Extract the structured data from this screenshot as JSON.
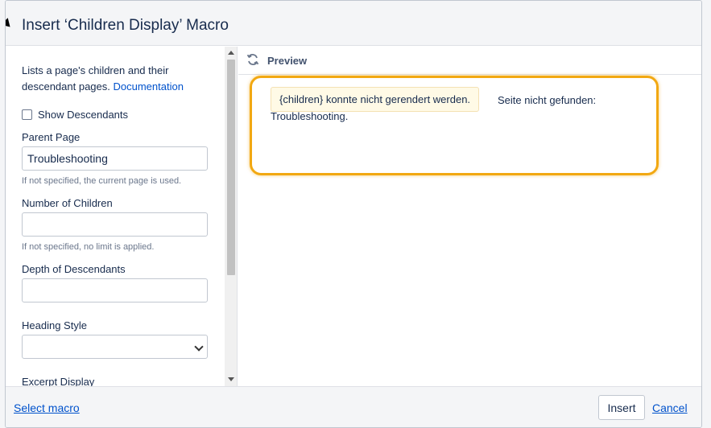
{
  "dialog": {
    "title": "Insert ‘Children Display’ Macro"
  },
  "form": {
    "description": "Lists a page's children and their descendant pages.",
    "documentation_link": "Documentation",
    "show_descendants_label": "Show Descendants",
    "parent_page": {
      "label": "Parent Page",
      "value": "Troubleshooting",
      "help": "If not specified, the current page is used."
    },
    "number_of_children": {
      "label": "Number of Children",
      "value": "",
      "help": "If not specified, no limit is applied."
    },
    "depth_of_descendants": {
      "label": "Depth of Descendants",
      "value": ""
    },
    "heading_style": {
      "label": "Heading Style",
      "value": ""
    },
    "excerpt_display": {
      "label": "Excerpt Display",
      "value": ""
    }
  },
  "preview": {
    "title": "Preview",
    "error_box": "{children} konnte nicht gerendert werden.",
    "error_text_line1": "Seite nicht gefunden:",
    "error_text_line2": "Troubleshooting."
  },
  "footer": {
    "select_macro": "Select macro",
    "insert": "Insert",
    "cancel": "Cancel"
  },
  "colors": {
    "link": "#0052cc",
    "highlight": "#f2a812",
    "warning_bg": "#fffae6"
  },
  "icons": {
    "refresh": "refresh-icon",
    "chevron": "chevron-down-icon"
  }
}
